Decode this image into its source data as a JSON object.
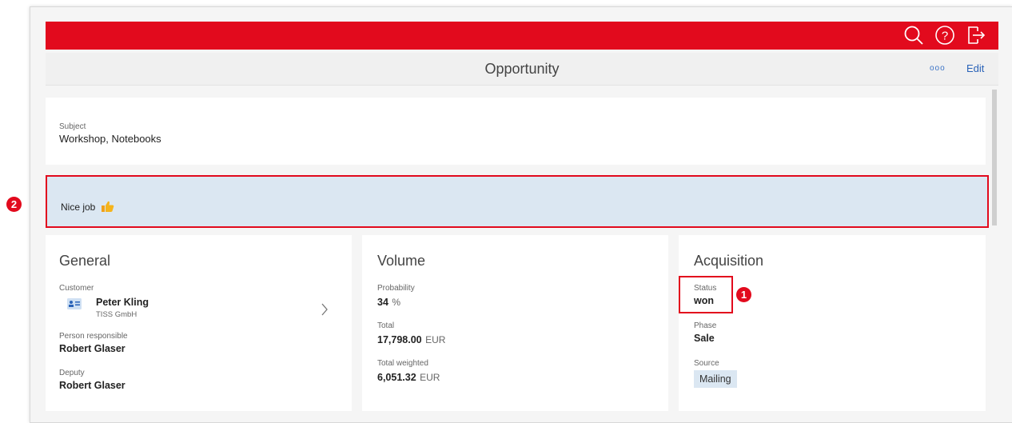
{
  "header": {
    "title": "Opportunity",
    "more_label": "ooo",
    "edit_label": "Edit"
  },
  "subject": {
    "label": "Subject",
    "value": "Workshop, Notebooks"
  },
  "note": {
    "text": "Nice job"
  },
  "general": {
    "title": "General",
    "customer_label": "Customer",
    "customer_name": "Peter Kling",
    "customer_company": "TISS GmbH",
    "person_label": "Person responsible",
    "person_value": "Robert Glaser",
    "deputy_label": "Deputy",
    "deputy_value": "Robert Glaser"
  },
  "volume": {
    "title": "Volume",
    "probability_label": "Probability",
    "probability_value": "34",
    "probability_unit": "%",
    "total_label": "Total",
    "total_value": "17,798.00",
    "total_unit": "EUR",
    "weighted_label": "Total weighted",
    "weighted_value": "6,051.32",
    "weighted_unit": "EUR"
  },
  "acquisition": {
    "title": "Acquisition",
    "status_label": "Status",
    "status_value": "won",
    "phase_label": "Phase",
    "phase_value": "Sale",
    "source_label": "Source",
    "source_value": "Mailing"
  },
  "markers": {
    "one": "1",
    "two": "2"
  },
  "colors": {
    "brand": "#e20a1d",
    "highlight": "#dbe7f2",
    "link": "#2a63b8"
  },
  "icons": [
    "search-icon",
    "help-icon",
    "logout-icon",
    "contact-card-icon",
    "chevron-right-icon",
    "thumbs-up-icon"
  ]
}
